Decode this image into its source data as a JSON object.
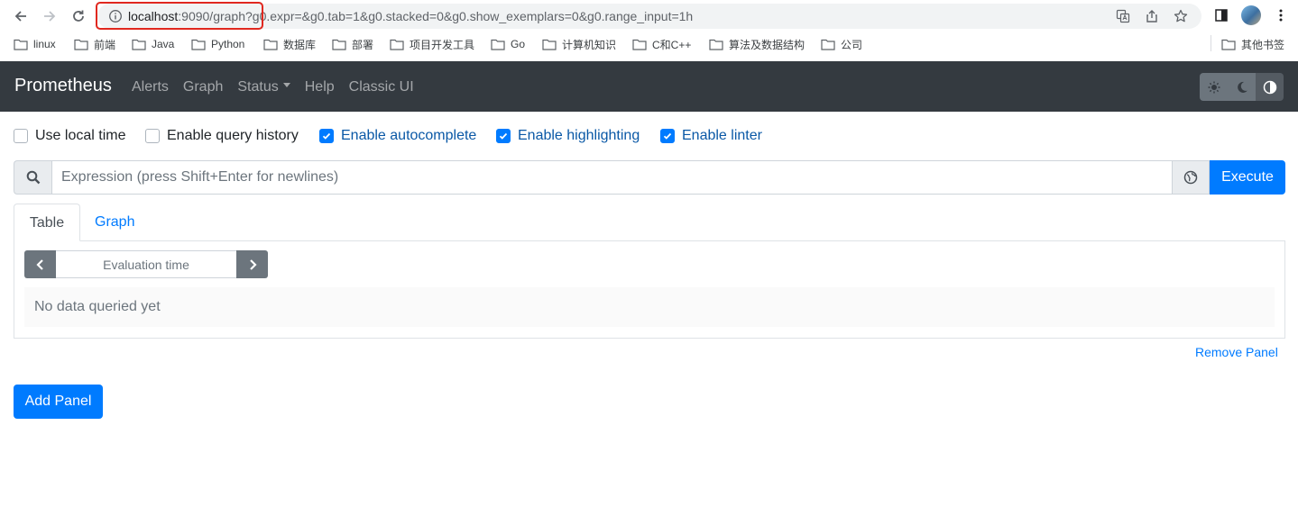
{
  "browser": {
    "url_host": "localhost",
    "url_port_path": ":9090/graph",
    "url_query": "?g0.expr=&g0.tab=1&g0.stacked=0&g0.show_exemplars=0&g0.range_input=1h",
    "highlight_color": "#e0281f"
  },
  "bookmarks": {
    "items": [
      "linux",
      "前端",
      "Java",
      "Python",
      "数据库",
      "部署",
      "项目开发工具",
      "Go",
      "计算机知识",
      "C和C++",
      "算法及数据结构",
      "公司"
    ],
    "other": "其他书签"
  },
  "navbar": {
    "brand": "Prometheus",
    "links": [
      "Alerts",
      "Graph",
      "Status",
      "Help",
      "Classic UI"
    ],
    "background": "#343a40"
  },
  "settings": {
    "use_local_time": {
      "label": "Use local time",
      "checked": false
    },
    "query_history": {
      "label": "Enable query history",
      "checked": false
    },
    "autocomplete": {
      "label": "Enable autocomplete",
      "checked": true
    },
    "highlighting": {
      "label": "Enable highlighting",
      "checked": true
    },
    "linter": {
      "label": "Enable linter",
      "checked": true
    }
  },
  "query": {
    "placeholder": "Expression (press Shift+Enter for newlines)",
    "execute_label": "Execute",
    "accent": "#007bff"
  },
  "tabs": [
    "Table",
    "Graph"
  ],
  "table_panel": {
    "eval_placeholder": "Evaluation time",
    "no_data": "No data queried yet"
  },
  "actions": {
    "remove_panel": "Remove Panel",
    "add_panel": "Add Panel"
  }
}
